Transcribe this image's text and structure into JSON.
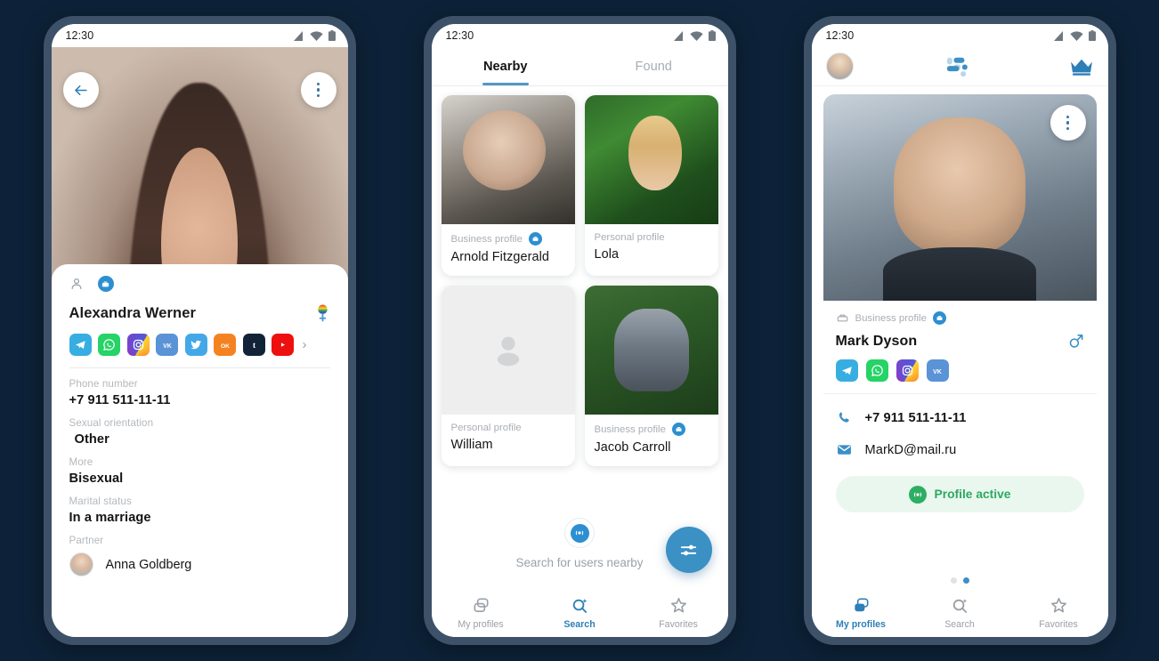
{
  "theme": {
    "background": "#0d2238",
    "phone_frame": "#3d5268",
    "accent_blue": "#2d7fb8",
    "badge_blue": "#2d8fd0",
    "active_green": "#2fa95f"
  },
  "phone1": {
    "statusbar": {
      "time": "12:30",
      "icons": [
        "signal-icon",
        "wifi-icon",
        "battery-icon"
      ]
    },
    "back_button": "back-arrow-icon",
    "menu_button": "kebab-menu-icon",
    "carousel": {
      "total": 3,
      "active_index": 1
    },
    "profile_types": [
      "person-outline-icon",
      "briefcase-badge-icon"
    ],
    "name": "Alexandra Werner",
    "gender_icon": "rainbow-female-gender-icon",
    "socials": [
      "telegram",
      "whatsapp",
      "instagram",
      "vk",
      "twitter",
      "odnoklassniki",
      "tumblr",
      "youtube"
    ],
    "socials_more": "›",
    "fields": [
      {
        "label": "Phone number",
        "value": "+7 911 511-11-11",
        "indent": false
      },
      {
        "label": "Sexual orientation",
        "value": "Other",
        "indent": true
      },
      {
        "label": "More",
        "value": "Bisexual",
        "indent": false
      },
      {
        "label": "Marital status",
        "value": "In a marriage",
        "indent": false
      }
    ],
    "partner": {
      "label": "Partner",
      "name": "Anna Goldberg",
      "avatar": "partner-avatar"
    }
  },
  "phone2": {
    "statusbar": {
      "time": "12:30"
    },
    "tabs": [
      {
        "label": "Nearby",
        "active": true
      },
      {
        "label": "Found",
        "active": false
      }
    ],
    "cards": [
      {
        "kind": "Business profile",
        "business": true,
        "name": "Arnold Fitzgerald",
        "photo": "photo-man-microphone"
      },
      {
        "kind": "Personal profile",
        "business": false,
        "name": "Lola",
        "photo": "photo-woman-green-foliage"
      },
      {
        "kind": "Personal profile",
        "business": false,
        "name": "William",
        "photo": "placeholder-avatar"
      },
      {
        "kind": "Business profile",
        "business": true,
        "name": "Jacob Carroll",
        "photo": "photo-man-blazer"
      }
    ],
    "search_label": "Search for users nearby",
    "search_icon": "radar-nearby-icon",
    "fab_icon": "filter-sliders-icon",
    "nav": [
      {
        "label": "My profiles",
        "icon": "cards-stack-icon",
        "active": false
      },
      {
        "label": "Search",
        "icon": "search-sparkle-icon",
        "active": true
      },
      {
        "label": "Favorites",
        "icon": "star-icon",
        "active": false
      }
    ]
  },
  "phone3": {
    "statusbar": {
      "time": "12:30"
    },
    "header": {
      "avatar": "user-avatar",
      "logo": "app-logo-icon",
      "crown": "crown-premium-icon"
    },
    "menu_button": "kebab-menu-icon",
    "kind": "Business profile",
    "kind_icon": "briefcase-outline-icon",
    "kind_badge": "briefcase-badge-icon",
    "name": "Mark Dyson",
    "gender_icon": "male-gender-icon",
    "socials": [
      "telegram",
      "whatsapp",
      "instagram",
      "vk"
    ],
    "contacts": [
      {
        "icon": "phone-icon",
        "value": "+7 911 511-11-11",
        "bold": true
      },
      {
        "icon": "mail-icon",
        "value": "MarkD@mail.ru",
        "bold": false
      }
    ],
    "status_pill": {
      "label": "Profile active",
      "icon": "broadcast-icon"
    },
    "page_dots": {
      "total": 2,
      "active_index": 1
    },
    "nav": [
      {
        "label": "My profiles",
        "icon": "cards-stack-icon",
        "active": true
      },
      {
        "label": "Search",
        "icon": "search-sparkle-icon",
        "active": false
      },
      {
        "label": "Favorites",
        "icon": "star-icon",
        "active": false
      }
    ]
  }
}
